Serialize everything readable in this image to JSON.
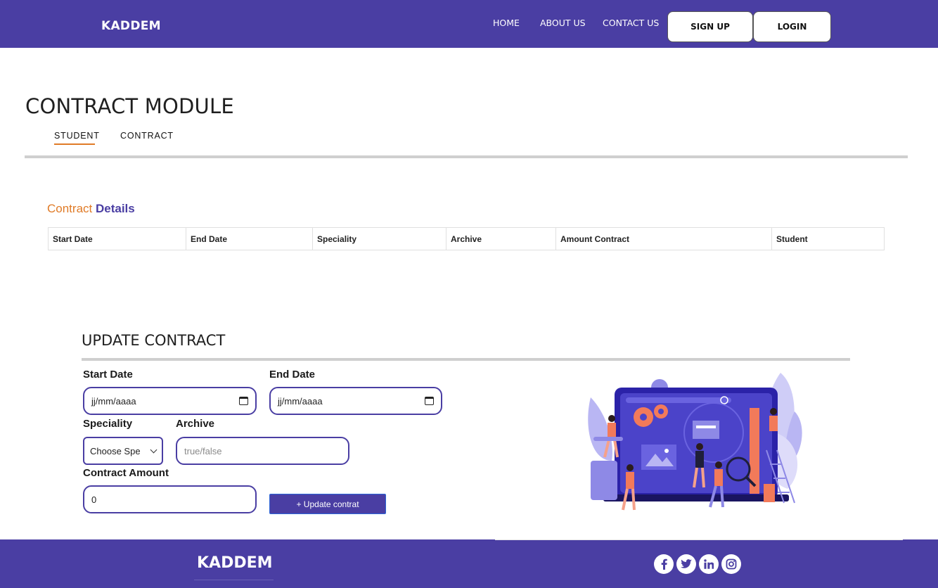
{
  "header": {
    "brand": "KADDEM",
    "nav": [
      "HOME",
      "ABOUT US",
      "CONTACT US"
    ],
    "signup_label": "SIGN UP",
    "login_label": "LOGIN"
  },
  "page": {
    "title": "CONTRACT MODULE",
    "tabs": [
      "STUDENT",
      "CONTRACT"
    ],
    "active_tab": "STUDENT"
  },
  "details": {
    "heading_part1": "Contract",
    "heading_part2": "Details",
    "columns": [
      "Start Date",
      "End Date",
      "Speciality",
      "Archive",
      "Amount Contract",
      "Student"
    ],
    "rows": []
  },
  "update_form": {
    "title": "UPDATE CONTRACT",
    "start_date": {
      "label": "Start Date",
      "value": "jj/mm/aaaa"
    },
    "end_date": {
      "label": "End Date",
      "value": "jj/mm/aaaa"
    },
    "speciality": {
      "label": "Speciality",
      "value": "Choose Spe"
    },
    "archive": {
      "label": "Archive",
      "placeholder": "true/false"
    },
    "amount": {
      "label": "Contract Amount",
      "value": "0"
    },
    "submit_label": "+ Update contrat"
  },
  "footer": {
    "brand": "KADDEM",
    "social_icons": [
      "facebook-icon",
      "twitter-icon",
      "linkedin-icon",
      "instagram-icon"
    ]
  },
  "colors": {
    "primary": "#4a3ea3",
    "accent": "#e07b27",
    "rule": "#cfcfcf"
  }
}
